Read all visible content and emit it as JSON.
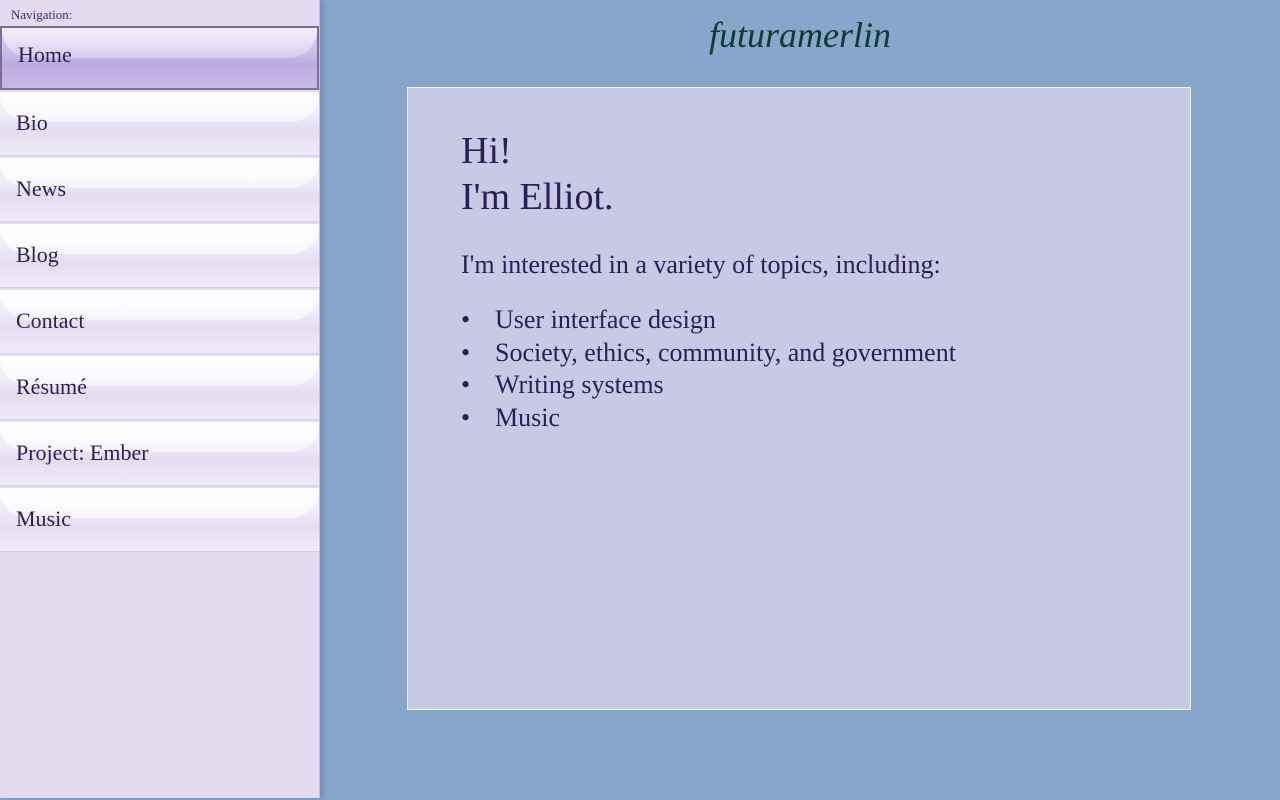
{
  "site": {
    "title": "futuramerlin"
  },
  "nav": {
    "caption": "Navigation:",
    "items": [
      {
        "label": "Home",
        "active": true
      },
      {
        "label": "Bio"
      },
      {
        "label": "News"
      },
      {
        "label": "Blog"
      },
      {
        "label": "Contact"
      },
      {
        "label": "Résumé"
      },
      {
        "label": "Project: Ember"
      },
      {
        "label": "Music"
      }
    ]
  },
  "main": {
    "greeting_line1": "Hi!",
    "greeting_line2": "I'm Elliot.",
    "intro": "I'm interested in a variety of topics, including:",
    "topics": [
      "User interface design",
      "Society, ethics, community, and government",
      "Writing systems",
      "Music"
    ]
  },
  "colors": {
    "page_background": "#86a7cb",
    "sidebar_background": "#e3dcf0",
    "content_background": "#c7c9e5",
    "text": "#2b1d57",
    "title": "#0f3a2f"
  }
}
